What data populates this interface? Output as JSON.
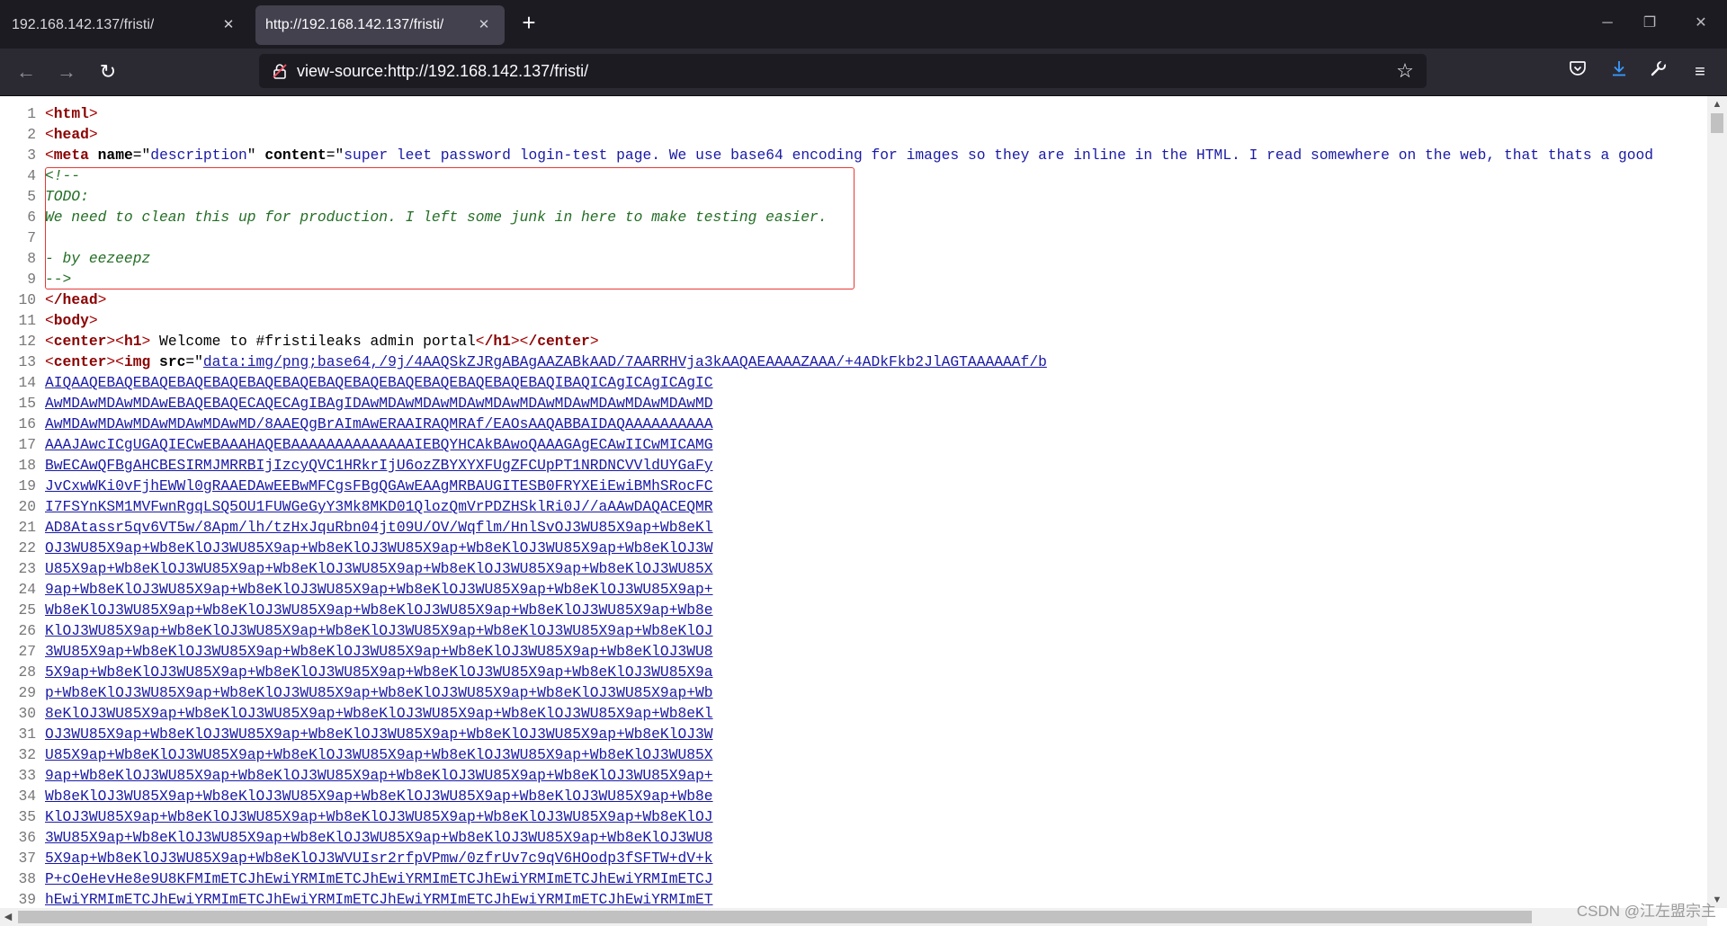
{
  "browser": {
    "tabs": [
      {
        "label": "192.168.142.137/fristi/",
        "active": false
      },
      {
        "label": "http://192.168.142.137/fristi/",
        "active": true
      }
    ],
    "url": "view-source:http://192.168.142.137/fristi/"
  },
  "source": {
    "line_numbers": [
      "1",
      "2",
      "3",
      "4",
      "5",
      "6",
      "7",
      "8",
      "9",
      "10",
      "11",
      "12",
      "13",
      "14",
      "15",
      "16",
      "17",
      "18",
      "19",
      "20",
      "21",
      "22",
      "23",
      "24",
      "25",
      "26",
      "27",
      "28",
      "29",
      "30",
      "31",
      "32",
      "33",
      "34",
      "35",
      "36",
      "37",
      "38",
      "39"
    ],
    "l1": "html",
    "l2": "head",
    "l3": {
      "tag": "meta",
      "a1": "name",
      "v1": "description",
      "a2": "content",
      "v2": "super leet password login-test page. We use base64 encoding for images so they are inline in the HTML. I read somewhere on the web, that thats a good"
    },
    "comment": [
      "<!--",
      "TODO:",
      "We need to clean this up for production. I left some junk in here to make testing easier.",
      "",
      "- by eezeepz",
      "-->"
    ],
    "l10": "/head",
    "l11": "body",
    "l12": {
      "t1": "center",
      "t2": "h1",
      "text": " Welcome to #fristileaks admin portal",
      "t3": "/h1",
      "t4": "/center"
    },
    "l13": {
      "t1": "center",
      "t2": "img",
      "attr": "src",
      "link": "data:img/png;base64,/9j/4AAQSkZJRgABAgAAZABkAAD/7AARRHVja3kAAQAEAAAAZAAA/+4ADkFkb2JlAGTAAAAAAf/b"
    },
    "base64_lines": [
      "AIQAAQEBAQEBAQEBAQEBAQEBAQEBAQEBAQEBAQEBAQEBAQEBAQEBAQEBAQIBAQICAgICAgICAgIC",
      "AwMDAwMDAwMDAwEBAQEBAQECAQECAgIBAgIDAwMDAwMDAwMDAwMDAwMDAwMDAwMDAwMDAwMDAwMD",
      "AwMDAwMDAwMDAwMDAwMDAwMD/8AAEQgBrAImAwERAAIRAQMRAf/EAOsAAQABBAIDAQAAAAAAAAAA",
      "AAAJAwcICgUGAQIECwEBAAAHAQEBAAAAAAAAAAAAAAIEBQYHCAkBAwoQAAAGAgECAwIICwMICAMG",
      "BwECAwQFBgAHCBESIRMJMRRBIjIzcyQVC1HRkrIjU6ozZBYXYXFUgZFCUpPT1NRDNCVVldUYGaFy",
      "JvCxwWKi0vFjhEWWl0gRAAEDAwEEBwMFCgsFBgQGAwEAAgMRBAUGITESB0FRYXEiEwiBMhSRocFC",
      "I7FSYnKSM1MVFwnRgqLSQ5OU1FUWGeGyY3Mk8MKD01QlozQmVrPDZHSklRi0J//aAAwDAQACEQMR",
      "AD8Atassr5qv6VT5w/8Apm/lh/tzHxJquRbn04jt09U/OV/Wqflm/HnlSvOJ3WU85X9ap+Wb8eKl",
      "OJ3WU85X9ap+Wb8eKlOJ3WU85X9ap+Wb8eKlOJ3WU85X9ap+Wb8eKlOJ3WU85X9ap+Wb8eKlOJ3W",
      "U85X9ap+Wb8eKlOJ3WU85X9ap+Wb8eKlOJ3WU85X9ap+Wb8eKlOJ3WU85X9ap+Wb8eKlOJ3WU85X",
      "9ap+Wb8eKlOJ3WU85X9ap+Wb8eKlOJ3WU85X9ap+Wb8eKlOJ3WU85X9ap+Wb8eKlOJ3WU85X9ap+",
      "Wb8eKlOJ3WU85X9ap+Wb8eKlOJ3WU85X9ap+Wb8eKlOJ3WU85X9ap+Wb8eKlOJ3WU85X9ap+Wb8e",
      "KlOJ3WU85X9ap+Wb8eKlOJ3WU85X9ap+Wb8eKlOJ3WU85X9ap+Wb8eKlOJ3WU85X9ap+Wb8eKlOJ",
      "3WU85X9ap+Wb8eKlOJ3WU85X9ap+Wb8eKlOJ3WU85X9ap+Wb8eKlOJ3WU85X9ap+Wb8eKlOJ3WU8",
      "5X9ap+Wb8eKlOJ3WU85X9ap+Wb8eKlOJ3WU85X9ap+Wb8eKlOJ3WU85X9ap+Wb8eKlOJ3WU85X9a",
      "p+Wb8eKlOJ3WU85X9ap+Wb8eKlOJ3WU85X9ap+Wb8eKlOJ3WU85X9ap+Wb8eKlOJ3WU85X9ap+Wb",
      "8eKlOJ3WU85X9ap+Wb8eKlOJ3WU85X9ap+Wb8eKlOJ3WU85X9ap+Wb8eKlOJ3WU85X9ap+Wb8eKl",
      "OJ3WU85X9ap+Wb8eKlOJ3WU85X9ap+Wb8eKlOJ3WU85X9ap+Wb8eKlOJ3WU85X9ap+Wb8eKlOJ3W",
      "U85X9ap+Wb8eKlOJ3WU85X9ap+Wb8eKlOJ3WU85X9ap+Wb8eKlOJ3WU85X9ap+Wb8eKlOJ3WU85X",
      "9ap+Wb8eKlOJ3WU85X9ap+Wb8eKlOJ3WU85X9ap+Wb8eKlOJ3WU85X9ap+Wb8eKlOJ3WU85X9ap+",
      "Wb8eKlOJ3WU85X9ap+Wb8eKlOJ3WU85X9ap+Wb8eKlOJ3WU85X9ap+Wb8eKlOJ3WU85X9ap+Wb8e",
      "KlOJ3WU85X9ap+Wb8eKlOJ3WU85X9ap+Wb8eKlOJ3WU85X9ap+Wb8eKlOJ3WU85X9ap+Wb8eKlOJ",
      "3WU85X9ap+Wb8eKlOJ3WU85X9ap+Wb8eKlOJ3WU85X9ap+Wb8eKlOJ3WU85X9ap+Wb8eKlOJ3WU8",
      "5X9ap+Wb8eKlOJ3WU85X9ap+Wb8eKlOJ3WVUIsr2rfpVPmw/0zfrUv7c9qV6HOodp3fSFTW+dV+k",
      "P+cOeHevHe8e9U8KFMImETCJhEwiYRMImETCJhEwiYRMImETCJhEwiYRMImETCJhEwiYRMImETCJ",
      "hEwiYRMImETCJhEwiYRMImETCJhEwiYRMImETCJhEwiYRMImETCJhEwiYRMImETCJhEwiYRMImET"
    ]
  },
  "watermark": "CSDN @江左盟宗主"
}
